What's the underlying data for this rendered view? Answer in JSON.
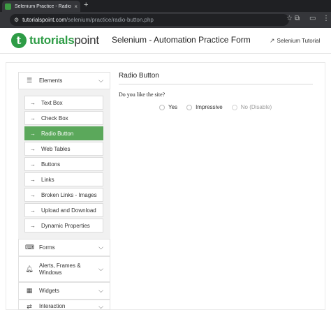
{
  "browser": {
    "tab_title": "Selenium Practice - Radio Bu...",
    "tab_close": "×",
    "new_tab": "+",
    "url_host": "tutorialspoint.com",
    "url_path": "/selenium/practice/radio-button.php",
    "icons": [
      "back-icon",
      "site-info-icon",
      "bookmark-star-icon",
      "extensions-icon",
      "tab-search-icon"
    ]
  },
  "header": {
    "logo_mark": "t",
    "logo_bold": "tutorials",
    "logo_thin": "point",
    "page_title": "Selenium - Automation Practice Form",
    "tutorial_link": "Selenium Tutorial"
  },
  "sidebar": {
    "sections": [
      {
        "label": "Elements",
        "icon": "hamburger-icon"
      },
      {
        "label": "Forms",
        "icon": "keyboard-icon"
      },
      {
        "label": "Alerts, Frames &",
        "label2": "Windows",
        "icon": "bell-icon"
      },
      {
        "label": "Widgets",
        "icon": "grid-icon"
      },
      {
        "label": "Interaction",
        "icon": "swap-icon"
      }
    ],
    "items": [
      {
        "label": "Text Box"
      },
      {
        "label": "Check Box"
      },
      {
        "label": "Radio Button",
        "active": true
      },
      {
        "label": "Web Tables"
      },
      {
        "label": "Buttons"
      },
      {
        "label": "Links"
      },
      {
        "label": "Broken Links - Images"
      },
      {
        "label": "Upload and Download"
      },
      {
        "label": "Dynamic Properties"
      }
    ]
  },
  "main": {
    "title": "Radio Button",
    "question": "Do you like the site?",
    "options": [
      {
        "label": "Yes",
        "disabled": false
      },
      {
        "label": "Impressive",
        "disabled": false
      },
      {
        "label": "No (Disable)",
        "disabled": true
      }
    ]
  },
  "colors": {
    "brand_green": "#2e9c46",
    "active_item": "#5ba85b"
  }
}
